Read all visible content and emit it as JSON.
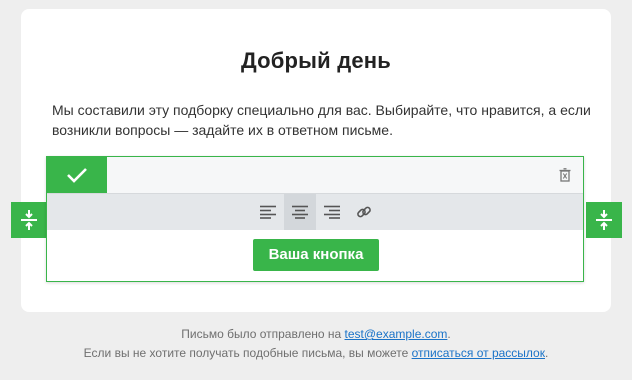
{
  "email": {
    "title": "Добрый день",
    "intro": "Мы составили эту подборку специально для вас. Выбирайте, что нравится, а если возникли вопросы — задайте их в ответном письме.",
    "button_label": "Ваша кнопка"
  },
  "editor": {
    "icons": {
      "confirm": "checkmark-icon",
      "delete": "trash-icon",
      "align_left": "align-left-icon",
      "align_center": "align-center-icon",
      "align_right": "align-right-icon",
      "link": "link-icon",
      "resize": "resize-vertical-icon"
    },
    "active_alignment": "center",
    "accent_color": "#39b54a"
  },
  "footer": {
    "line1_prefix": "Письмо было отправлено на ",
    "email_link": "test@example.com",
    "line1_suffix": ".",
    "line2_prefix": "Если вы не хотите получать подобные письма, вы можете ",
    "unsubscribe_link": "отписаться от рассылок",
    "line2_suffix": "."
  }
}
